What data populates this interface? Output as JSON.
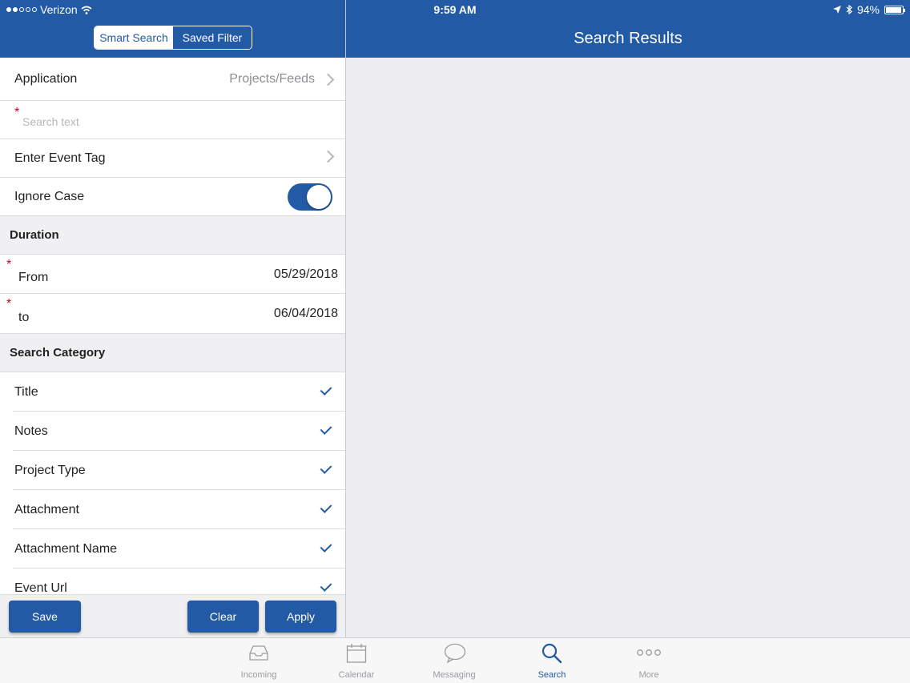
{
  "status_bar": {
    "carrier": "Verizon",
    "time": "9:59 AM",
    "battery": "94%"
  },
  "segmented": {
    "items": [
      "Smart Search",
      "Saved Filter"
    ],
    "selected": "Smart Search"
  },
  "header": {
    "title": "Search Results"
  },
  "form": {
    "application_label": "Application",
    "application_value": "Projects/Feeds",
    "search_placeholder": "Search text",
    "event_tag_label": "Enter Event Tag",
    "ignore_case_label": "Ignore Case"
  },
  "duration": {
    "title": "Duration",
    "from_label": "From",
    "from_value": "05/29/2018",
    "to_label": "to",
    "to_value": "06/04/2018"
  },
  "category": {
    "title": "Search Category",
    "items": [
      "Title",
      "Notes",
      "Project Type",
      "Attachment",
      "Attachment Name",
      "Event Url"
    ]
  },
  "actions": {
    "save": "Save",
    "clear": "Clear",
    "apply": "Apply"
  },
  "tabs": [
    {
      "label": "Incoming",
      "icon": "inbox-icon"
    },
    {
      "label": "Calendar",
      "icon": "calendar-icon"
    },
    {
      "label": "Messaging",
      "icon": "chat-bubble-icon"
    },
    {
      "label": "Search",
      "icon": "search-icon"
    },
    {
      "label": "More",
      "icon": "more-dots-icon"
    }
  ],
  "colors": {
    "primary": "#235aa5",
    "required": "#d0021b"
  }
}
